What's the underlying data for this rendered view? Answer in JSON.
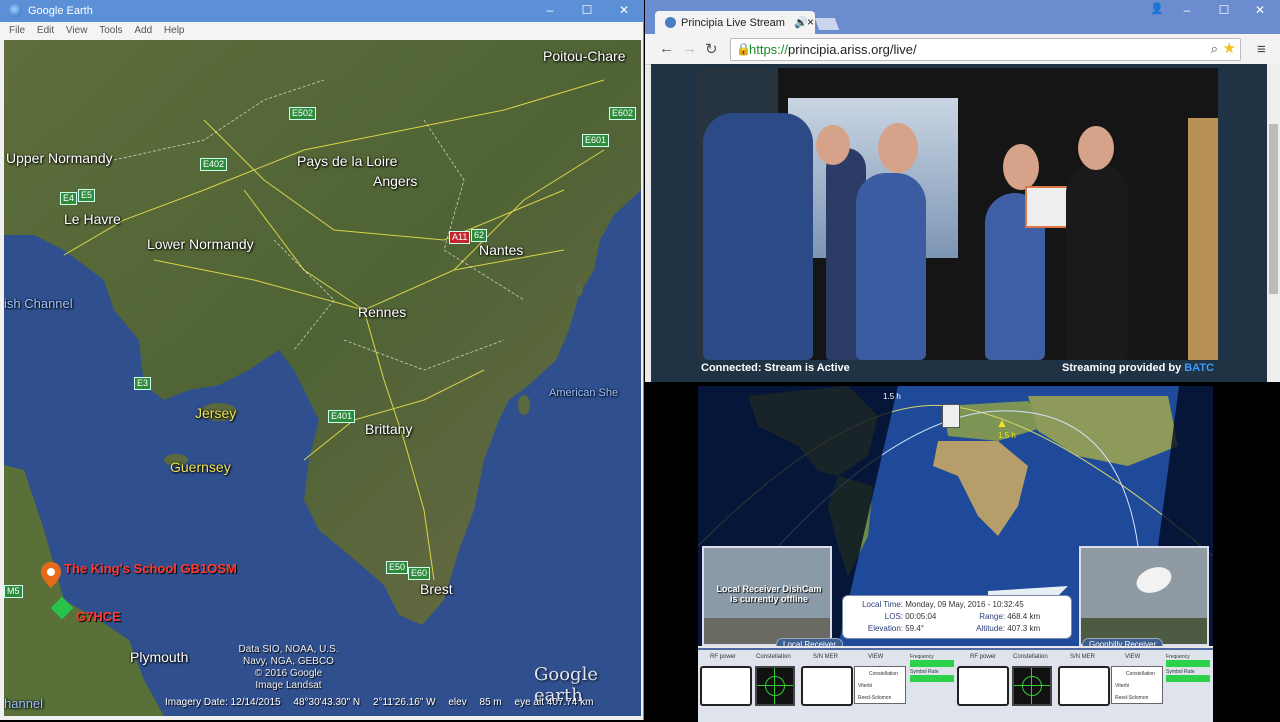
{
  "google_earth": {
    "window_title": "Google Earth",
    "menu": [
      "File",
      "Edit",
      "View",
      "Tools",
      "Add",
      "Help"
    ],
    "map_labels": {
      "poitou": "Poitou-Chare",
      "upper_normandy": "Upper Normandy",
      "le_havre": "Le Havre",
      "lower_normandy": "Lower Normandy",
      "pays_de_la_loire": "Pays de la Loire",
      "angers": "Angers",
      "nantes": "Nantes",
      "rennes": "Rennes",
      "brittany": "Brittany",
      "brest": "Brest",
      "plymouth": "Plymouth",
      "jersey": "Jersey",
      "guernsey": "Guernsey",
      "english_channel": "ish Channel",
      "american_shelf": "American She",
      "channel_bottom": "hannel"
    },
    "roads": {
      "e502": "E502",
      "e602": "E602",
      "e601": "E601",
      "e402": "E402",
      "e5": "E5",
      "e44": "E4",
      "e3": "E3",
      "e401": "E401",
      "e50": "E50",
      "e60": "E60",
      "a11": "A11",
      "r62": "62",
      "m5": "M5"
    },
    "placemarks": {
      "kings_school": "The King's School GB1OSM",
      "g7hce": "G7HCE"
    },
    "attribution": [
      "Data SIO, NOAA, U.S. Navy, NGA, GEBCO",
      "© 2016 Google",
      "Image Landsat"
    ],
    "logo": "Google earth",
    "status": {
      "imagery_date": "Imagery Date: 12/14/2015",
      "lat": "48°30'43.30\" N",
      "lon": "2°11'26.16\" W",
      "elev_label": "elev",
      "elev": "85 m",
      "eye_alt": "eye alt 407.74 km"
    }
  },
  "chrome": {
    "tab_title": "Principia Live Stream",
    "url_scheme": "https://",
    "url_host": "principia.ariss.org",
    "url_path": "/live/",
    "stream_status": "Connected: Stream is Active",
    "streaming_provided": "Streaming provided by",
    "batc": "BATC"
  },
  "tracker": {
    "orbit_label_1": "1.5 h",
    "orbit_label_2": "1.5 h",
    "local_cam_text": "Local Receiver DishCam is currently offline",
    "local_receiver": "Local Receiver",
    "goonhilly_receiver": "Goonhilly Receiver",
    "info": {
      "local_time_label": "Local Time:",
      "local_time": "Monday, 09 May, 2016 - 10:32:45",
      "los_label": "LOS:",
      "los": "00:05:04",
      "range_label": "Range:",
      "range": "468.4 km",
      "elevation_label": "Elevation:",
      "elevation": "59.4°",
      "altitude_label": "Altitude:",
      "altitude": "407.3 km"
    },
    "panel": {
      "rf_power": "RF power",
      "constellation": "Constellation",
      "snr": "S/N MER",
      "vbox": "VIEW",
      "frequency": "Frequency",
      "symbol_rate": "Symbol Rate",
      "vbox_a": "Constellation",
      "vbox_b": "Viterbi",
      "vbox_c": "Reed-Solomon"
    }
  }
}
